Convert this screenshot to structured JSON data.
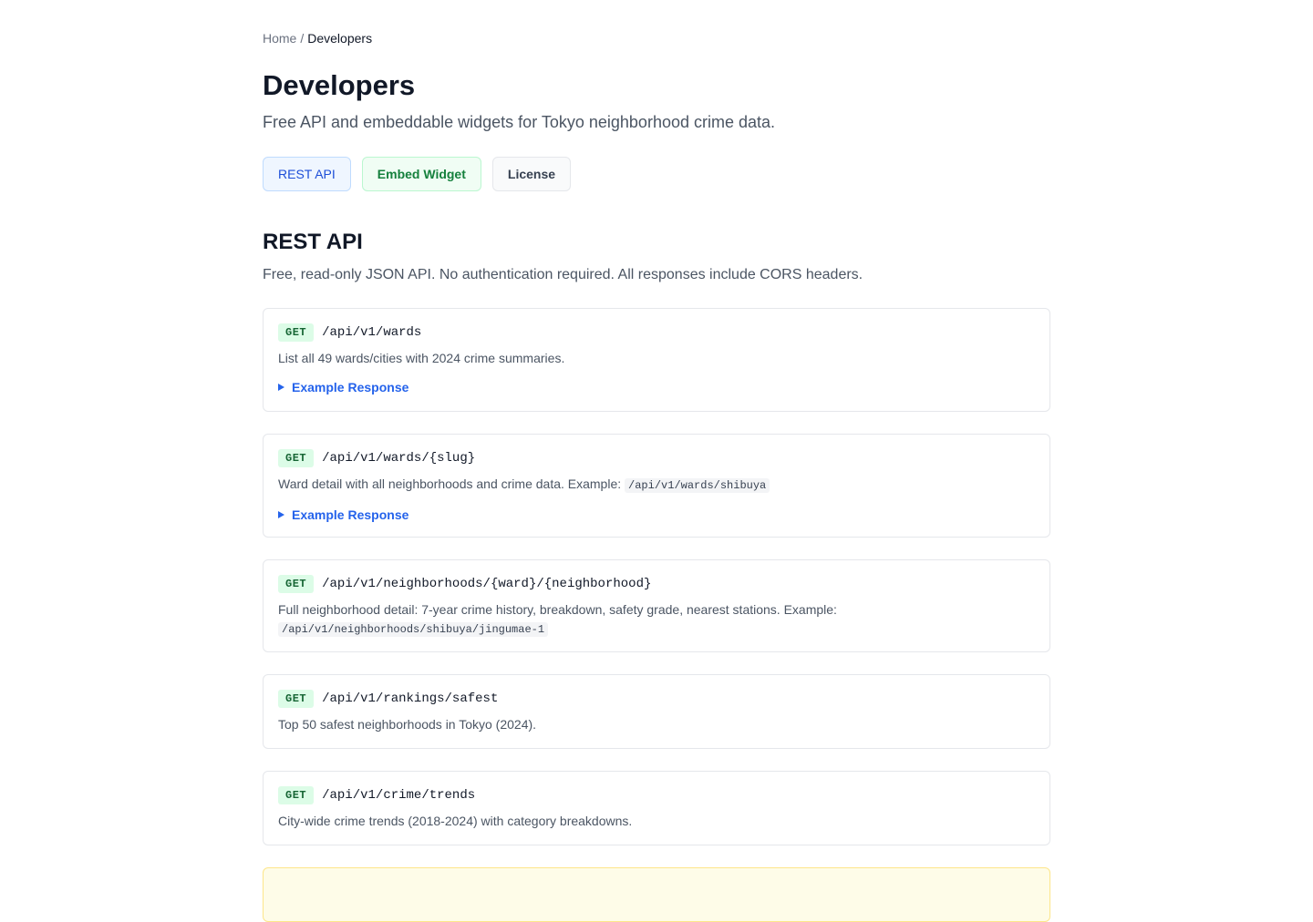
{
  "breadcrumb": {
    "home": "Home",
    "separator": "/",
    "current": "Developers"
  },
  "page": {
    "title": "Developers",
    "subtitle": "Free API and embeddable widgets for Tokyo neighborhood crime data."
  },
  "tabs": [
    {
      "label": "REST API",
      "color": "#1d4ed8"
    },
    {
      "label": "Embed Widget",
      "color": "#15803d"
    },
    {
      "label": "License",
      "color": "#374151"
    }
  ],
  "rest_api": {
    "title": "REST API",
    "description": "Free, read-only JSON API. No authentication required. All responses include CORS headers.",
    "example_label": "Example Response",
    "endpoints": [
      {
        "method": "GET",
        "path": "/api/v1/wards",
        "description": "List all 49 wards/cities with 2024 crime summaries.",
        "example_code": ""
      },
      {
        "method": "GET",
        "path": "/api/v1/wards/{slug}",
        "description": "Ward detail with all neighborhoods and crime data. Example:",
        "example_code": "/api/v1/wards/shibuya"
      },
      {
        "method": "GET",
        "path": "/api/v1/neighborhoods/{ward}/{neighborhood}",
        "description": "Full neighborhood detail: 7-year crime history, breakdown, safety grade, nearest stations. Example:",
        "example_code": "/api/v1/neighborhoods/shibuya/jingumae-1"
      },
      {
        "method": "GET",
        "path": "/api/v1/rankings/safest",
        "description": "Top 50 safest neighborhoods in Tokyo (2024).",
        "example_code": ""
      },
      {
        "method": "GET",
        "path": "/api/v1/crime/trends",
        "description": "City-wide crime trends (2018-2024) with category breakdowns.",
        "example_code": ""
      }
    ]
  },
  "colors": {
    "method_badge_bg": "#dcfce7",
    "method_badge_text": "#166534",
    "link_blue": "#2563eb"
  }
}
